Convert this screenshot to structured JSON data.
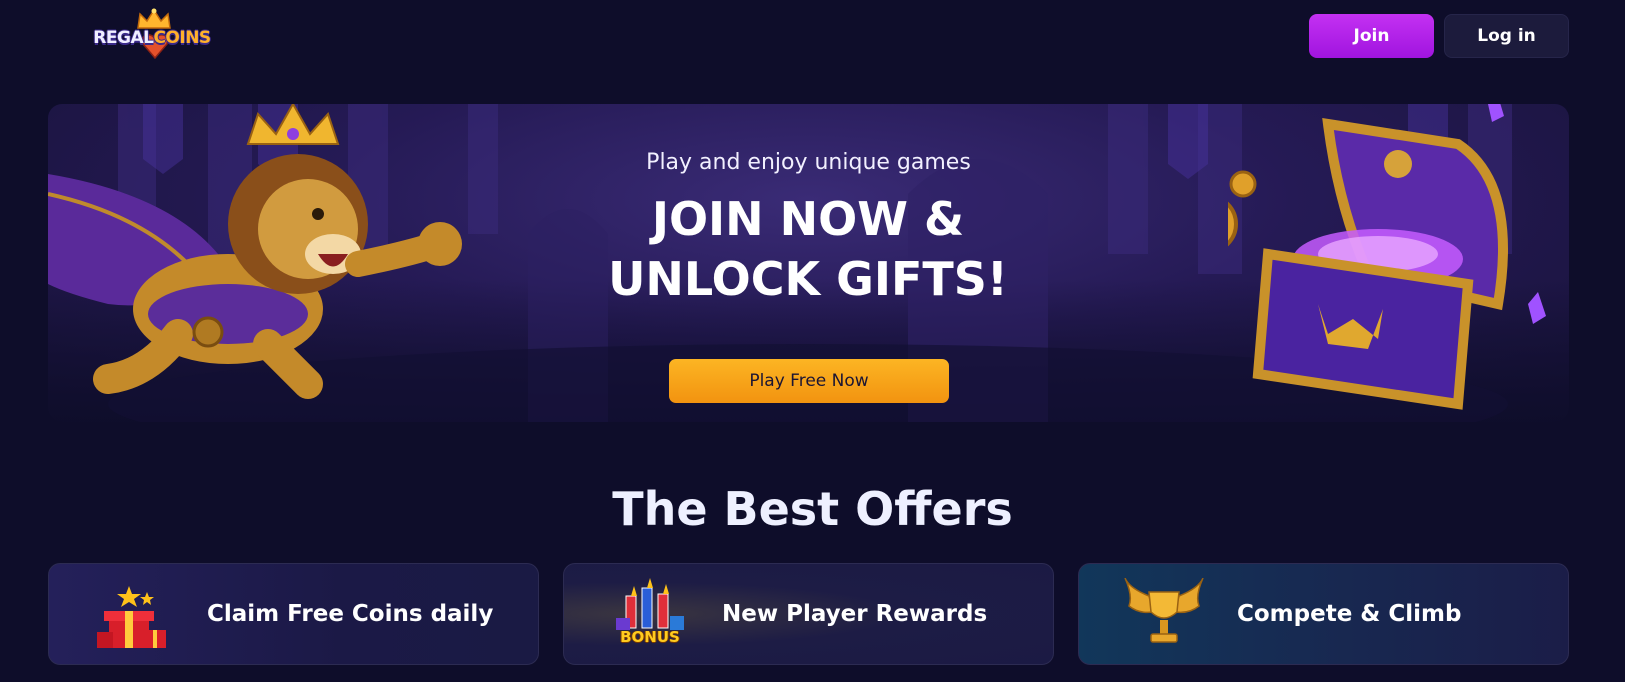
{
  "header": {
    "logo_word_1": "REGAL",
    "logo_word_2": "COINS",
    "join_label": "Join",
    "login_label": "Log in"
  },
  "hero": {
    "subtitle": "Play and enjoy unique games",
    "title_line_1": "JOIN NOW &",
    "title_line_2": "UNLOCK GIFTS!",
    "cta_label": "Play Free Now"
  },
  "offers": {
    "title": "The Best Offers",
    "items": [
      {
        "label": "Claim Free Coins daily",
        "icon": "gift-box-icon"
      },
      {
        "label": "New Player Rewards",
        "icon": "bonus-fireworks-icon",
        "icon_text": "BONUS"
      },
      {
        "label": "Compete & Climb",
        "icon": "winged-trophy-icon"
      }
    ]
  },
  "colors": {
    "background": "#0e0d2a",
    "join_button": "#b422ea",
    "cta_button": "#f7a41a",
    "card_border": "#2c2b52"
  }
}
